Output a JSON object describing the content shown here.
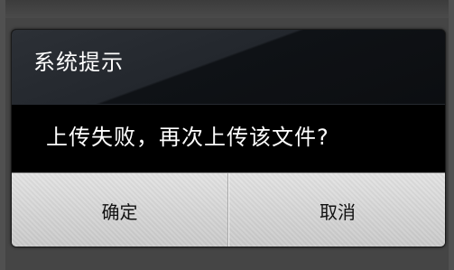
{
  "dialog": {
    "title": "系统提示",
    "message": "上传失败，再次上传该文件?",
    "buttons": {
      "confirm_label": "确定",
      "cancel_label": "取消"
    }
  },
  "colors": {
    "header_bg": "#23272d",
    "body_bg": "#000000",
    "button_bg": "#d4d4d4",
    "text_light": "#ffffff",
    "text_dark": "#111111"
  }
}
